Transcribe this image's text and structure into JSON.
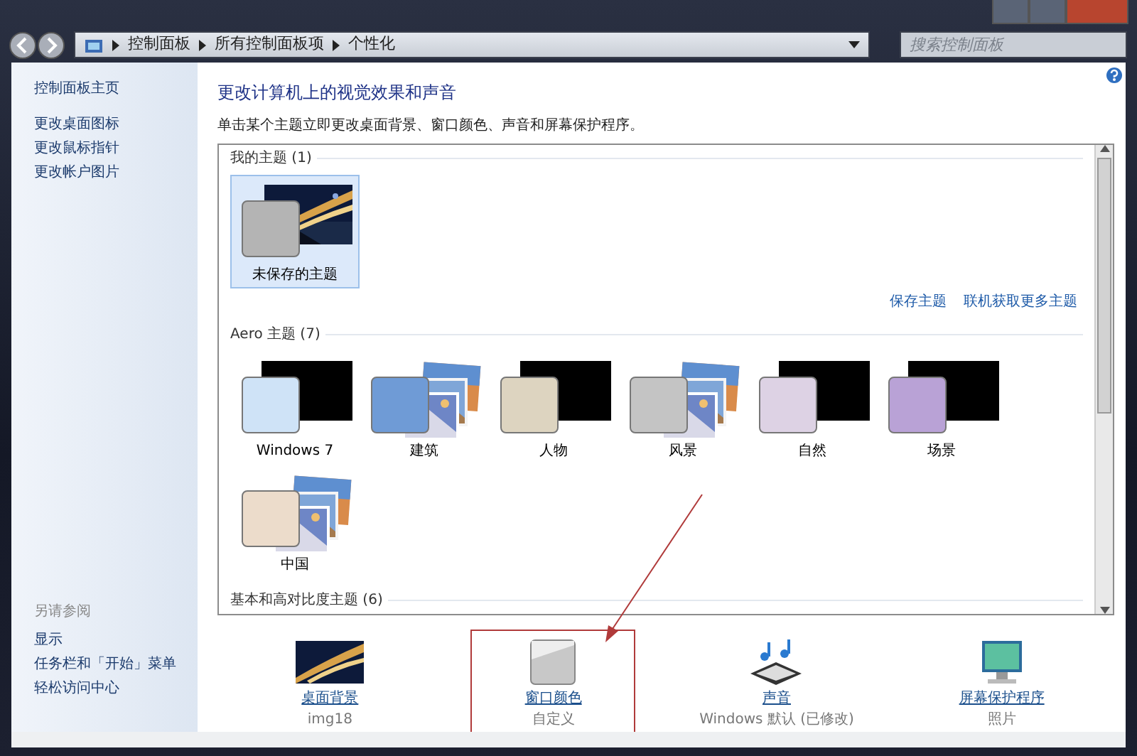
{
  "address_bar": {
    "segments": [
      "控制面板",
      "所有控制面板项",
      "个性化"
    ]
  },
  "search": {
    "placeholder": "搜索控制面板"
  },
  "sidebar": {
    "items": [
      "控制面板主页",
      "更改桌面图标",
      "更改鼠标指针",
      "更改帐户图片"
    ],
    "see_also": {
      "title": "另请参阅",
      "items": [
        "显示",
        "任务栏和「开始」菜单",
        "轻松访问中心"
      ]
    }
  },
  "main": {
    "title": "更改计算机上的视觉效果和声音",
    "description": "单击某个主题立即更改桌面背景、窗口颜色、声音和屏幕保护程序。",
    "groups": [
      {
        "title": "我的主题 (1)",
        "themes": [
          {
            "name": "未保存的主题",
            "color": "#b4b4b4",
            "selected": true
          }
        ],
        "links": [
          "保存主题",
          "联机获取更多主题"
        ]
      },
      {
        "title": "Aero 主题 (7)",
        "themes": [
          {
            "name": "Windows 7",
            "kind": "black",
            "color": "#cfe3f7",
            "selected": false
          },
          {
            "name": "建筑",
            "kind": "stack",
            "color": "#6f9bd6",
            "selected": false
          },
          {
            "name": "人物",
            "kind": "black",
            "color": "#ddd4c0",
            "selected": false
          },
          {
            "name": "风景",
            "kind": "stack",
            "color": "#c4c4c4",
            "selected": false
          },
          {
            "name": "自然",
            "kind": "black",
            "color": "#ddd2e4",
            "selected": false
          },
          {
            "name": "场景",
            "kind": "black",
            "color": "#b9a2d6",
            "selected": false
          },
          {
            "name": "中国",
            "kind": "stack",
            "color": "#ecdccb",
            "selected": false
          }
        ]
      },
      {
        "title": "基本和高对比度主题 (6)"
      }
    ]
  },
  "settings": [
    {
      "title": "桌面背景",
      "value": "img18",
      "kind": "wallpaper",
      "highlighted": false
    },
    {
      "title": "窗口颜色",
      "value": "自定义",
      "kind": "color",
      "highlighted": true
    },
    {
      "title": "声音",
      "value": "Windows 默认 (已修改)",
      "kind": "sound",
      "highlighted": false
    },
    {
      "title": "屏幕保护程序",
      "value": "照片",
      "kind": "screensaver",
      "highlighted": false
    }
  ]
}
